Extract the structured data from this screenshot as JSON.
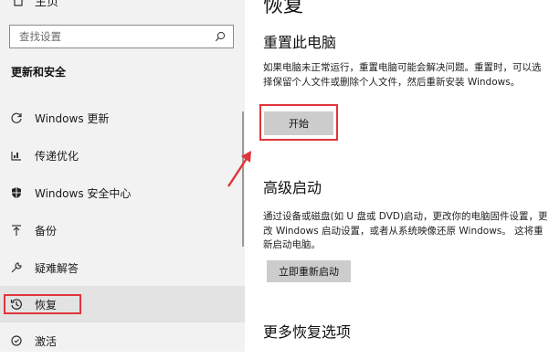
{
  "sidebar": {
    "home_label": "主页",
    "search_placeholder": "查找设置",
    "section_title": "更新和安全",
    "items": [
      {
        "label": "Windows 更新",
        "icon": "refresh-icon"
      },
      {
        "label": "传递优化",
        "icon": "delivery-optimization-icon"
      },
      {
        "label": "Windows 安全中心",
        "icon": "shield-icon"
      },
      {
        "label": "备份",
        "icon": "upload-arrow-icon"
      },
      {
        "label": "疑难解答",
        "icon": "wrench-icon"
      },
      {
        "label": "恢复",
        "icon": "history-clock-icon",
        "active": true
      },
      {
        "label": "激活",
        "icon": "activation-icon"
      }
    ]
  },
  "main": {
    "page_title": "恢复",
    "reset": {
      "heading": "重置此电脑",
      "description": "如果电脑未正常运行，重置电脑可能会解决问题。重置时，可以选择保留个人文件或删除个人文件，然后重新安装 Windows。",
      "button_label": "开始"
    },
    "advanced": {
      "heading": "高级启动",
      "description": "通过设备或磁盘(如 U 盘或 DVD)启动，更改你的电脑固件设置，更改 Windows 启动设置，或者从系统映像还原 Windows。 这将重新启动电脑。",
      "button_label": "立即重新启动"
    },
    "more": {
      "heading": "更多恢复选项"
    }
  },
  "colors": {
    "highlight_red": "#e0353a",
    "sidebar_bg": "#f2f2f2",
    "button_bg": "#cccccc"
  }
}
